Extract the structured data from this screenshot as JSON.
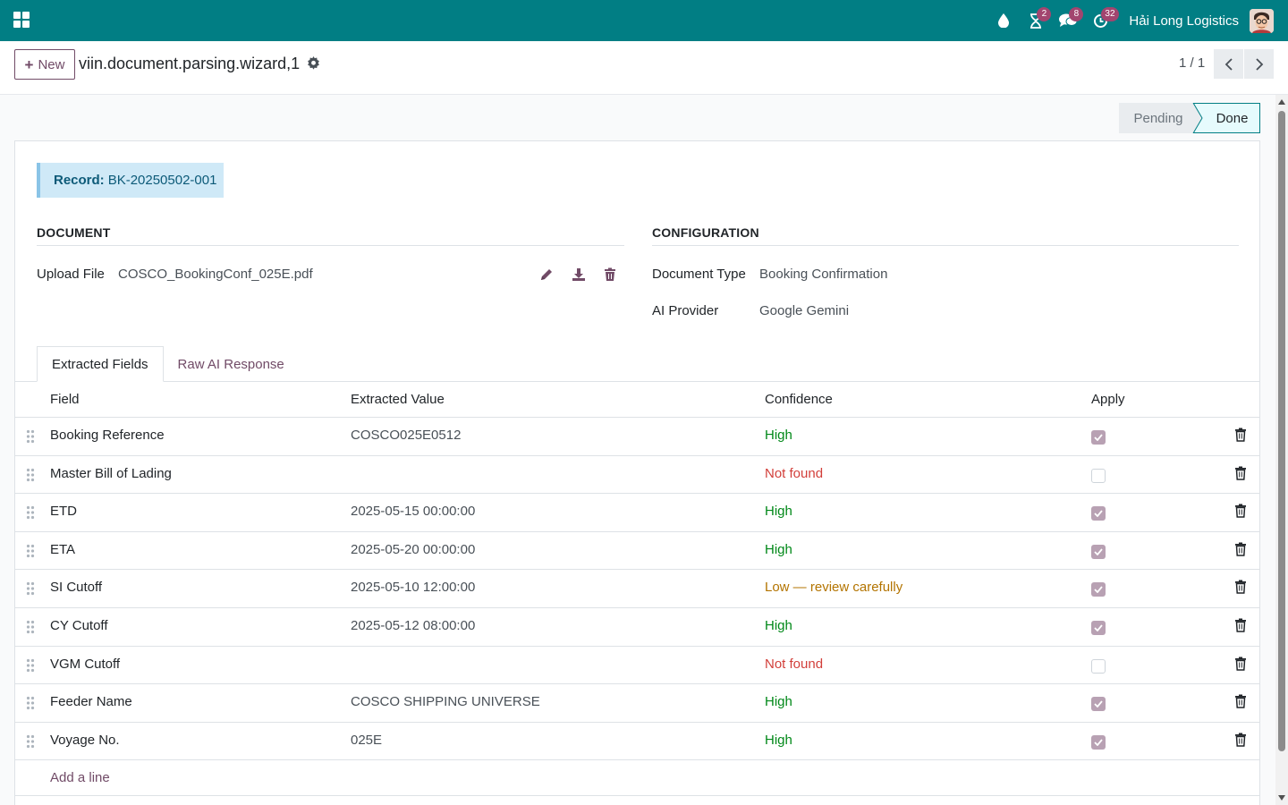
{
  "navbar": {
    "company": "Hải Long Logistics",
    "activity_count": "2",
    "messages_count": "8",
    "timer_count": "32",
    "bg_color": "#017e84"
  },
  "control_panel": {
    "new_label": "New",
    "record_title": "viin.document.parsing.wizard,1",
    "pager": "1 / 1"
  },
  "status": {
    "stages": [
      "Pending",
      "Done"
    ],
    "current": "Done"
  },
  "record": {
    "label": "Record:",
    "value": "BK-20250502-001"
  },
  "document": {
    "title": "DOCUMENT",
    "upload_label": "Upload File",
    "upload_value": "COSCO_BookingConf_025E.pdf"
  },
  "configuration": {
    "title": "CONFIGURATION",
    "doc_type_label": "Document Type",
    "doc_type_value": "Booking Confirmation",
    "ai_label": "AI Provider",
    "ai_value": "Google Gemini"
  },
  "tabs": [
    "Extracted Fields",
    "Raw AI Response"
  ],
  "table": {
    "columns": [
      "Field",
      "Extracted Value",
      "Confidence",
      "Apply"
    ],
    "rows": [
      {
        "field": "Booking Reference",
        "value": "COSCO025E0512",
        "confidence": "High",
        "level": "high",
        "apply": true
      },
      {
        "field": "Master Bill of Lading",
        "value": "",
        "confidence": "Not found",
        "level": "nf",
        "apply": false
      },
      {
        "field": "ETD",
        "value": "2025-05-15 00:00:00",
        "confidence": "High",
        "level": "high",
        "apply": true
      },
      {
        "field": "ETA",
        "value": "2025-05-20 00:00:00",
        "confidence": "High",
        "level": "high",
        "apply": true
      },
      {
        "field": "SI Cutoff",
        "value": "2025-05-10 12:00:00",
        "confidence": "Low — review carefully",
        "level": "low",
        "apply": true
      },
      {
        "field": "CY Cutoff",
        "value": "2025-05-12 08:00:00",
        "confidence": "High",
        "level": "high",
        "apply": true
      },
      {
        "field": "VGM Cutoff",
        "value": "",
        "confidence": "Not found",
        "level": "nf",
        "apply": false
      },
      {
        "field": "Feeder Name",
        "value": "COSCO SHIPPING UNIVERSE",
        "confidence": "High",
        "level": "high",
        "apply": true
      },
      {
        "field": "Voyage No.",
        "value": "025E",
        "confidence": "High",
        "level": "high",
        "apply": true
      }
    ],
    "add_line": "Add a line"
  }
}
